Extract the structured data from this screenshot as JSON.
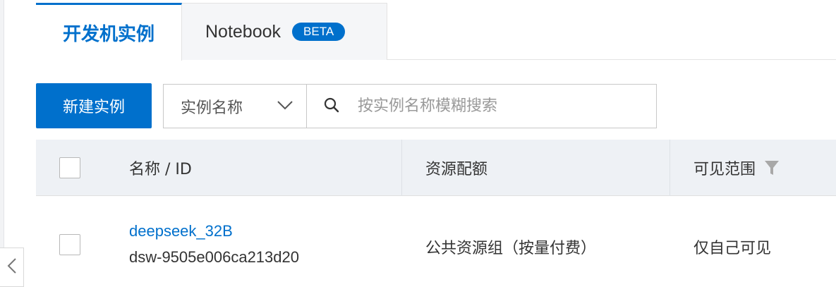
{
  "tabs": [
    {
      "label": "开发机实例",
      "active": true
    },
    {
      "label": "Notebook",
      "badge": "BETA",
      "active": false
    }
  ],
  "toolbar": {
    "new_button": "新建实例",
    "filter_select": "实例名称",
    "search_placeholder": "按实例名称模糊搜索"
  },
  "table": {
    "headers": {
      "name": "名称 / ID",
      "resource": "资源配额",
      "visibility": "可见范围"
    },
    "rows": [
      {
        "name": "deepseek_32B",
        "id": "dsw-9505e006ca213d20",
        "resource": "公共资源组（按量付费）",
        "visibility": "仅自己可见"
      }
    ]
  },
  "colors": {
    "accent": "#0070cc",
    "header_bg": "#eef1f5",
    "inactive_tab_bg": "#f5f6f8"
  },
  "icons": [
    "chevron-down-icon",
    "search-icon",
    "filter-icon",
    "chevron-left-icon"
  ]
}
